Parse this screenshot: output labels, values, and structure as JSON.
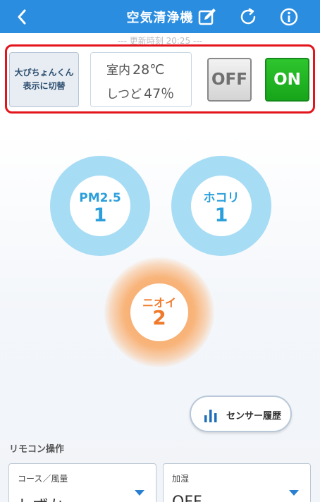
{
  "header": {
    "title": "空気清浄機",
    "back_icon": "chevron-left-icon",
    "edit_icon": "edit-icon",
    "refresh_icon": "refresh-icon",
    "info_icon": "info-icon"
  },
  "update_time": "--- 更新時刻 20:25 ---",
  "controls": {
    "switch_label": "大ぴちょんくん表示に切替",
    "room_label": "室内",
    "room_temp": "28℃",
    "humidity_label": "しつど",
    "humidity": "47％",
    "off_label": "OFF",
    "on_label": "ON"
  },
  "sensors": {
    "pm25": {
      "name": "PM2.5",
      "value": "1"
    },
    "dust": {
      "name": "ホコリ",
      "value": "1"
    },
    "odor": {
      "name": "ニオイ",
      "value": "2"
    }
  },
  "history_button": "センサー履歴",
  "remote": {
    "title": "リモコン操作",
    "course": {
      "caption": "コース／風量",
      "value": "しずか"
    },
    "humidify": {
      "caption": "加湿",
      "value": "OFF"
    }
  },
  "colors": {
    "header": "#2a8de0",
    "highlight": "#e3141b",
    "on": "#1fae22",
    "sensor_ring": "#a7dcf5",
    "odor": "#f5a764"
  }
}
